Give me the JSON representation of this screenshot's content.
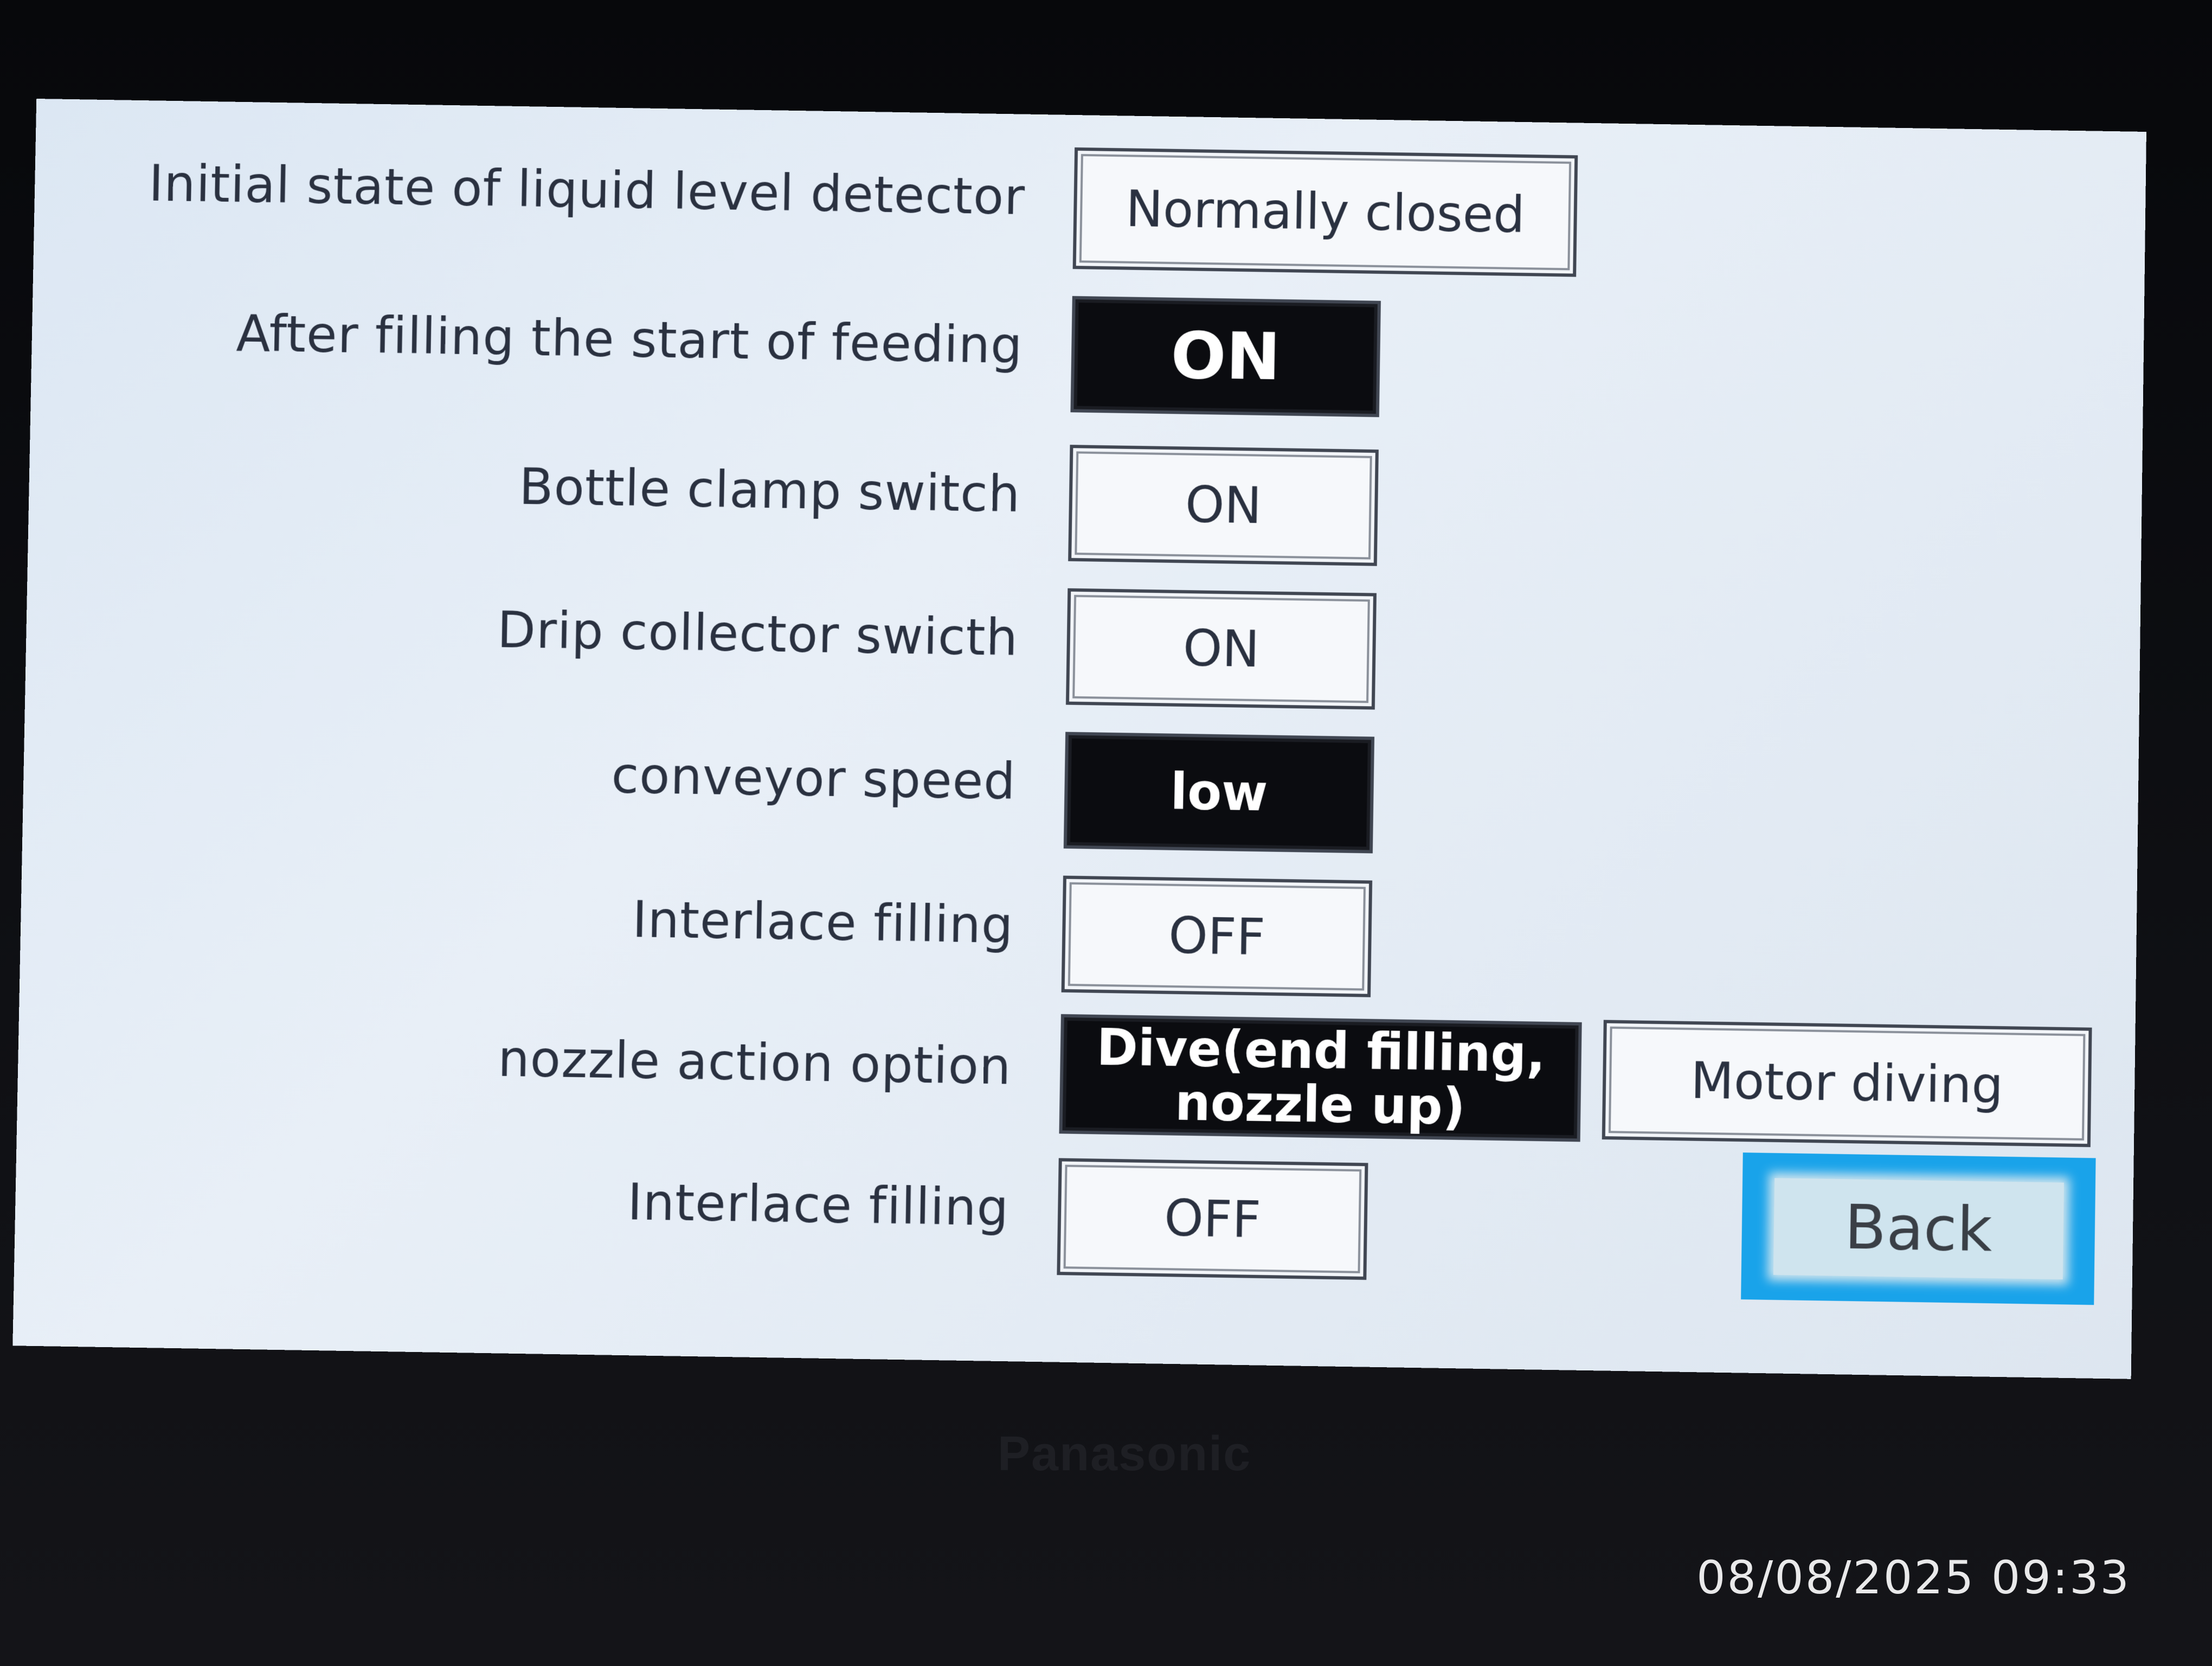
{
  "settings": {
    "rows": [
      {
        "label": "Initial state of liquid level detector",
        "value": "Normally closed",
        "active": false
      },
      {
        "label": "After filling the start of feeding",
        "value": "ON",
        "active": true
      },
      {
        "label": "Bottle clamp switch",
        "value": "ON",
        "active": false
      },
      {
        "label": "Drip collector swicth",
        "value": "ON",
        "active": false
      },
      {
        "label": "conveyor speed",
        "value": "low",
        "active": true
      },
      {
        "label": "Interlace filling",
        "value": "OFF",
        "active": false
      },
      {
        "label": "nozzle action option",
        "value": "Dive(end filling, nozzle up)",
        "active": true
      },
      {
        "label": "Interlace filling",
        "value": "OFF",
        "active": false
      }
    ],
    "nozzle_alt_option": "Motor diving",
    "back_label": "Back"
  },
  "device": {
    "brand": "Panasonic"
  },
  "photo_timestamp": "08/08/2025 09:33",
  "colors": {
    "screen_bg": "#e3ebf5",
    "active_bg": "#0b0c10",
    "back_accent": "#19a3ea"
  }
}
